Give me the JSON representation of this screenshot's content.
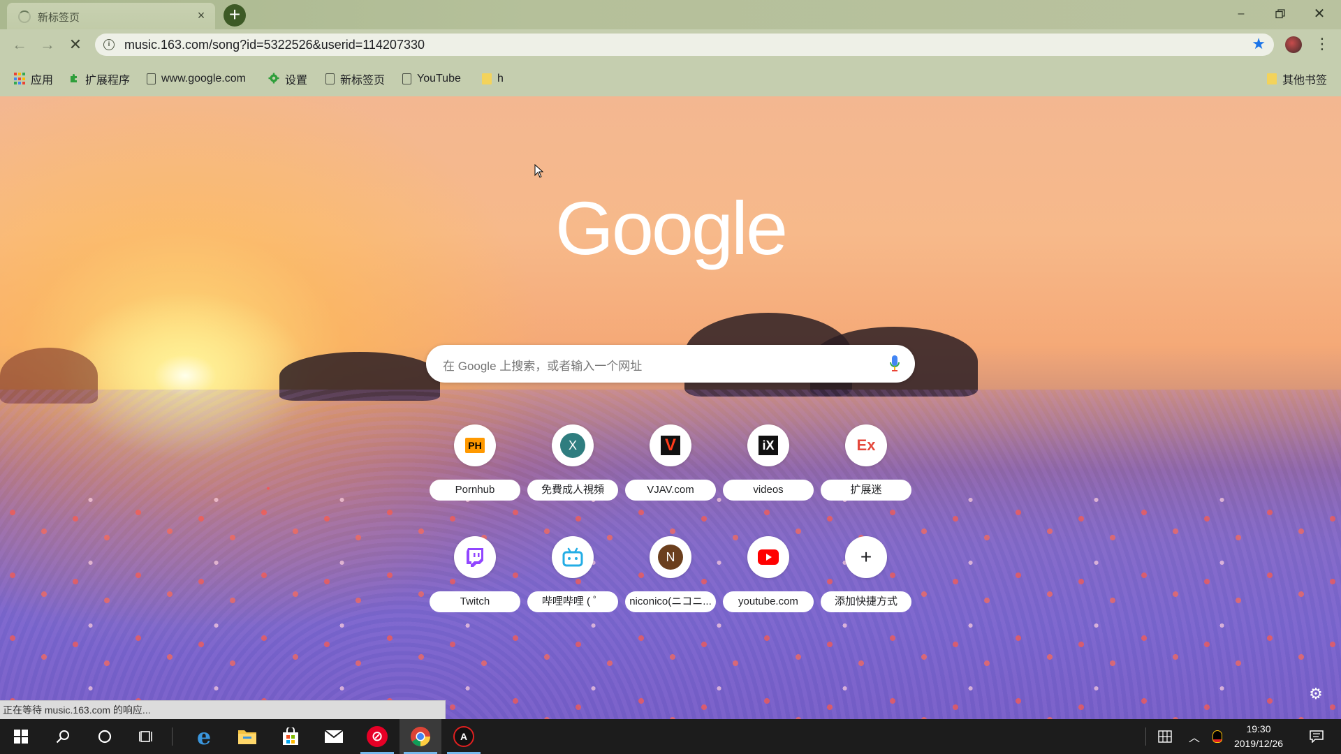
{
  "tab": {
    "title": "新标签页"
  },
  "omnibox": {
    "url": "music.163.com/song?id=5322526&userid=114207330"
  },
  "bookmarks": [
    {
      "label": "应用",
      "icon": "apps-grid-icon"
    },
    {
      "label": "扩展程序",
      "icon": "puzzle-icon"
    },
    {
      "label": "www.google.com",
      "icon": "page-icon"
    },
    {
      "label": "设置",
      "icon": "gear-icon"
    },
    {
      "label": "新标签页",
      "icon": "page-icon"
    },
    {
      "label": "YouTube",
      "icon": "page-icon"
    },
    {
      "label": "h",
      "icon": "folder-icon"
    }
  ],
  "other_bookmarks": "其他书签",
  "logo": "Google",
  "search": {
    "placeholder": "在 Google 上搜索，或者输入一个网址"
  },
  "shortcuts": [
    {
      "label": "Pornhub",
      "glyph": "PH"
    },
    {
      "label": "免費成人視頻",
      "glyph": "X"
    },
    {
      "label": "VJAV.com",
      "glyph": "V"
    },
    {
      "label": "videos",
      "glyph": "iX"
    },
    {
      "label": "扩展迷",
      "glyph": "Ex"
    },
    {
      "label": "Twitch",
      "glyph": "twitch"
    },
    {
      "label": "哔哩哔哩 ( ゜",
      "glyph": "tv"
    },
    {
      "label": "niconico(ニコニ...",
      "glyph": "N"
    },
    {
      "label": "youtube.com",
      "glyph": "play"
    },
    {
      "label": "添加快捷方式",
      "glyph": "+"
    }
  ],
  "status": "正在等待 music.163.com 的响应...",
  "clock": {
    "time": "19:30",
    "date": "2019/12/26"
  },
  "colors": {
    "accent": "#1a73e8",
    "chrome": "#c5ceaf",
    "taskbar": "#1c1c1c"
  }
}
